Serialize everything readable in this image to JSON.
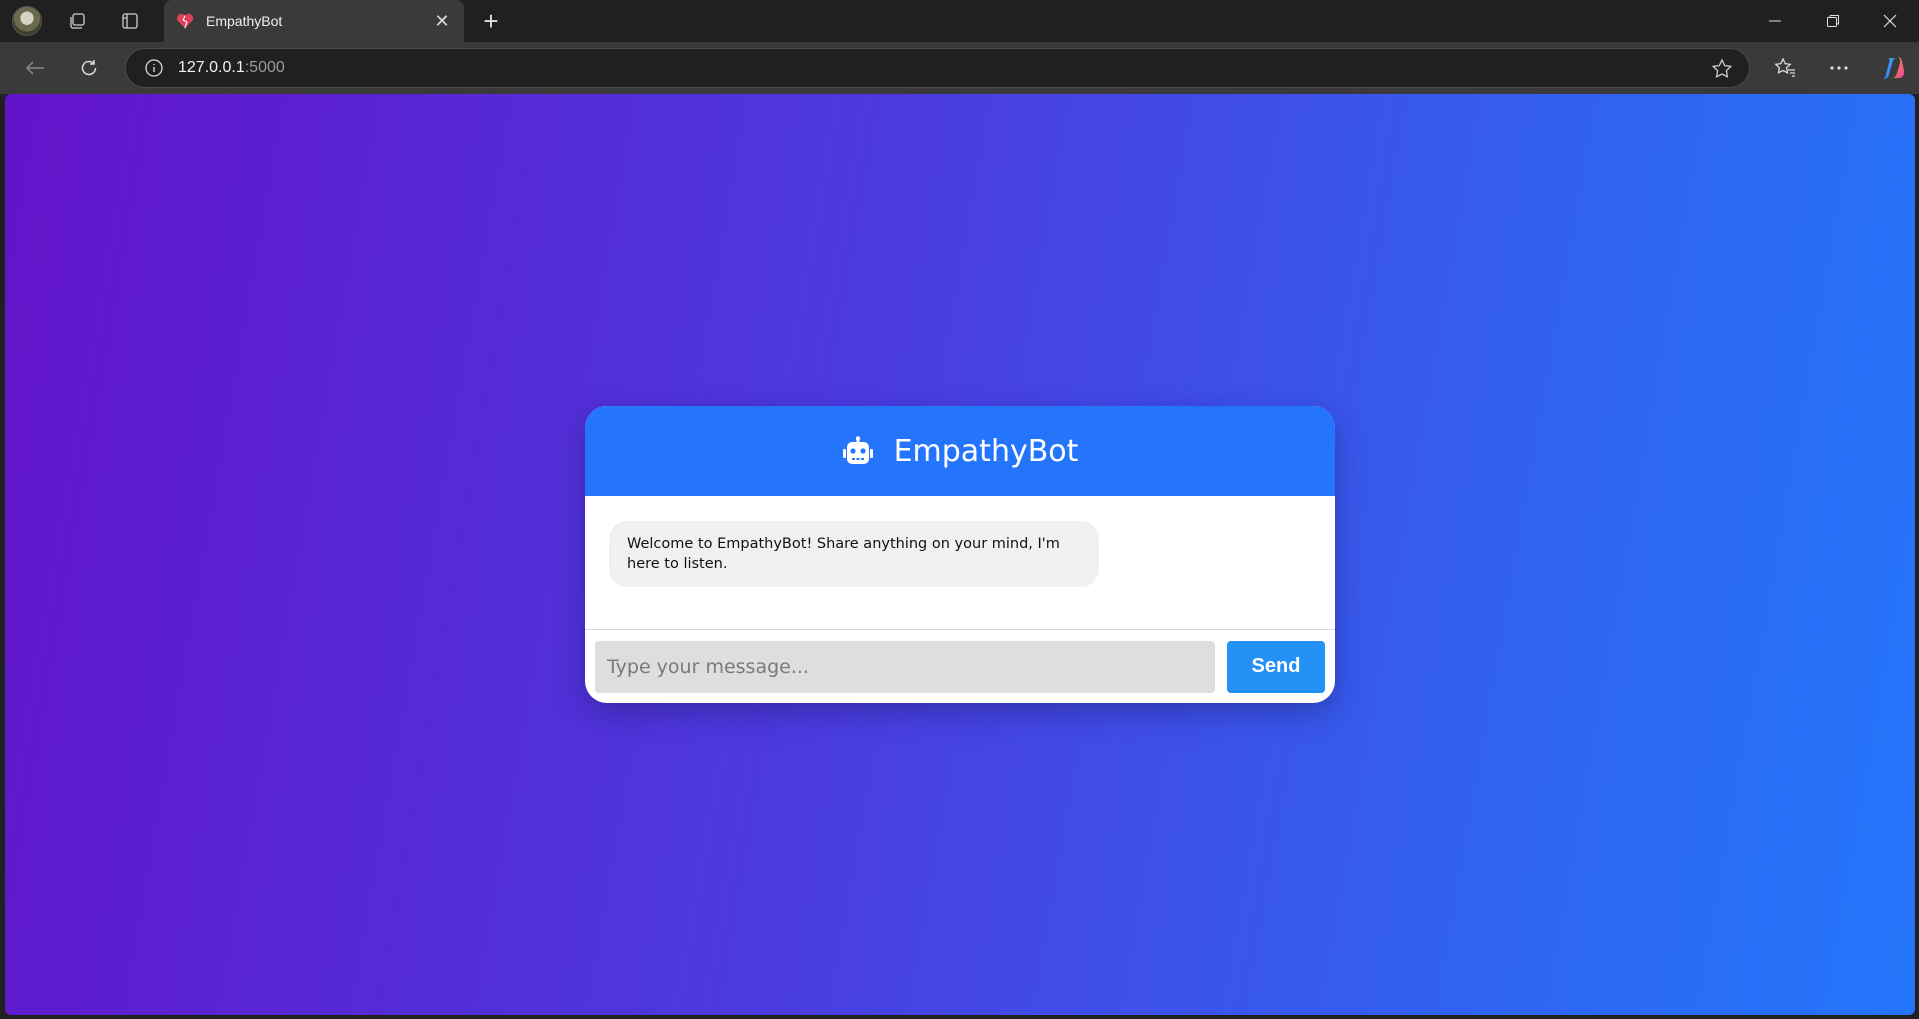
{
  "browser": {
    "tab": {
      "title": "EmpathyBot",
      "favicon": "heart-icon"
    },
    "address": {
      "host": "127.0.0.1",
      "port": ":5000"
    }
  },
  "app": {
    "header_title": "EmpathyBot",
    "messages": [
      {
        "sender": "bot",
        "text": "Welcome to EmpathyBot! Share anything on your mind, I'm here to listen."
      }
    ],
    "input": {
      "placeholder": "Type your message...",
      "value": ""
    },
    "send_label": "Send"
  },
  "colors": {
    "header": "#2575fc",
    "send_button": "#2391f5",
    "gradient_start": "#6313c9",
    "gradient_end": "#2475fb"
  }
}
